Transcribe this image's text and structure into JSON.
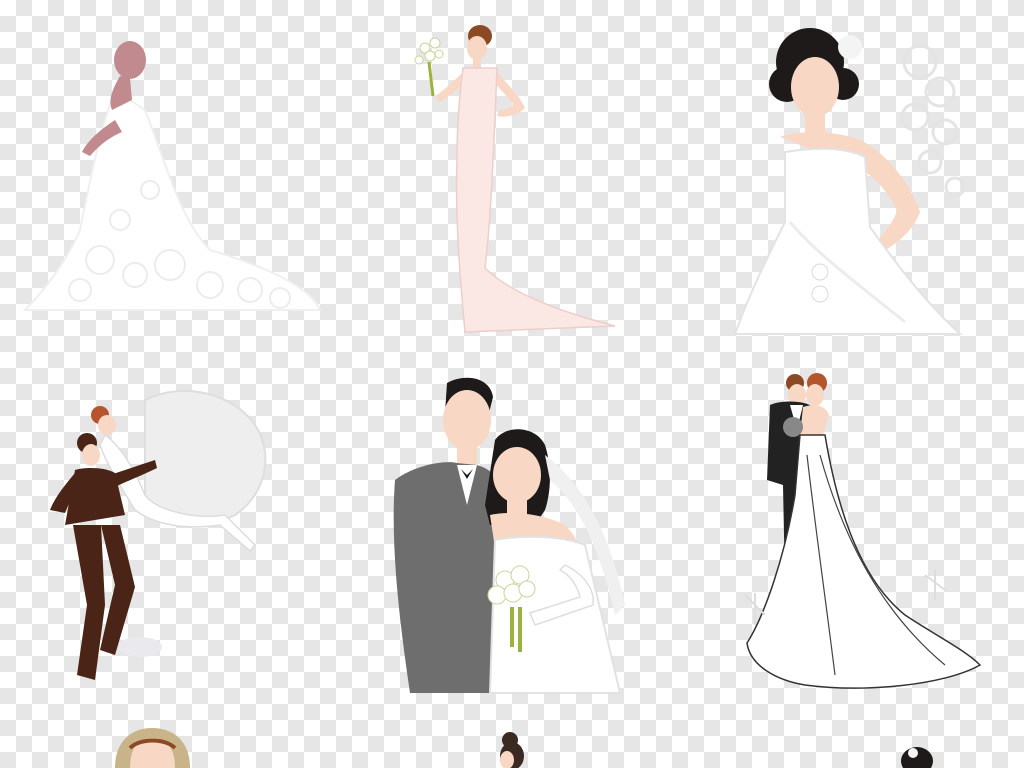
{
  "background": {
    "pattern": "transparency-checkerboard",
    "tile_light": "#ffffff",
    "tile_dark": "#e6e6e6"
  },
  "palette": {
    "skin": "#f8d7c4",
    "skin_shadow": "#eab79f",
    "dark_hair": "#1f1a1a",
    "brown_hair": "#8b4a24",
    "auburn_hair": "#b5552d",
    "gown_white": "#ffffff",
    "gown_pink": "#fbe7e4",
    "gown_shadow": "#e9e2e2",
    "veil": "#eeeeee",
    "suit_gray": "#6e6e6e",
    "suit_black": "#222222",
    "suit_brown": "#4a2416",
    "bouquet_green": "#9ab33c",
    "silhouette_mauve": "#c08a8f"
  },
  "figures": [
    {
      "icon": "lace-bride-silhouette-icon"
    },
    {
      "icon": "bride-with-bouquet-icon"
    },
    {
      "icon": "curly-haired-bride-icon"
    },
    {
      "icon": "groom-lifting-bride-icon"
    },
    {
      "icon": "couple-portrait-icon"
    },
    {
      "icon": "couple-standing-icon"
    },
    {
      "icon": "partial-bride-head-icon"
    },
    {
      "icon": "partial-bride-head-icon"
    },
    {
      "icon": "partial-bride-head-icon"
    }
  ]
}
